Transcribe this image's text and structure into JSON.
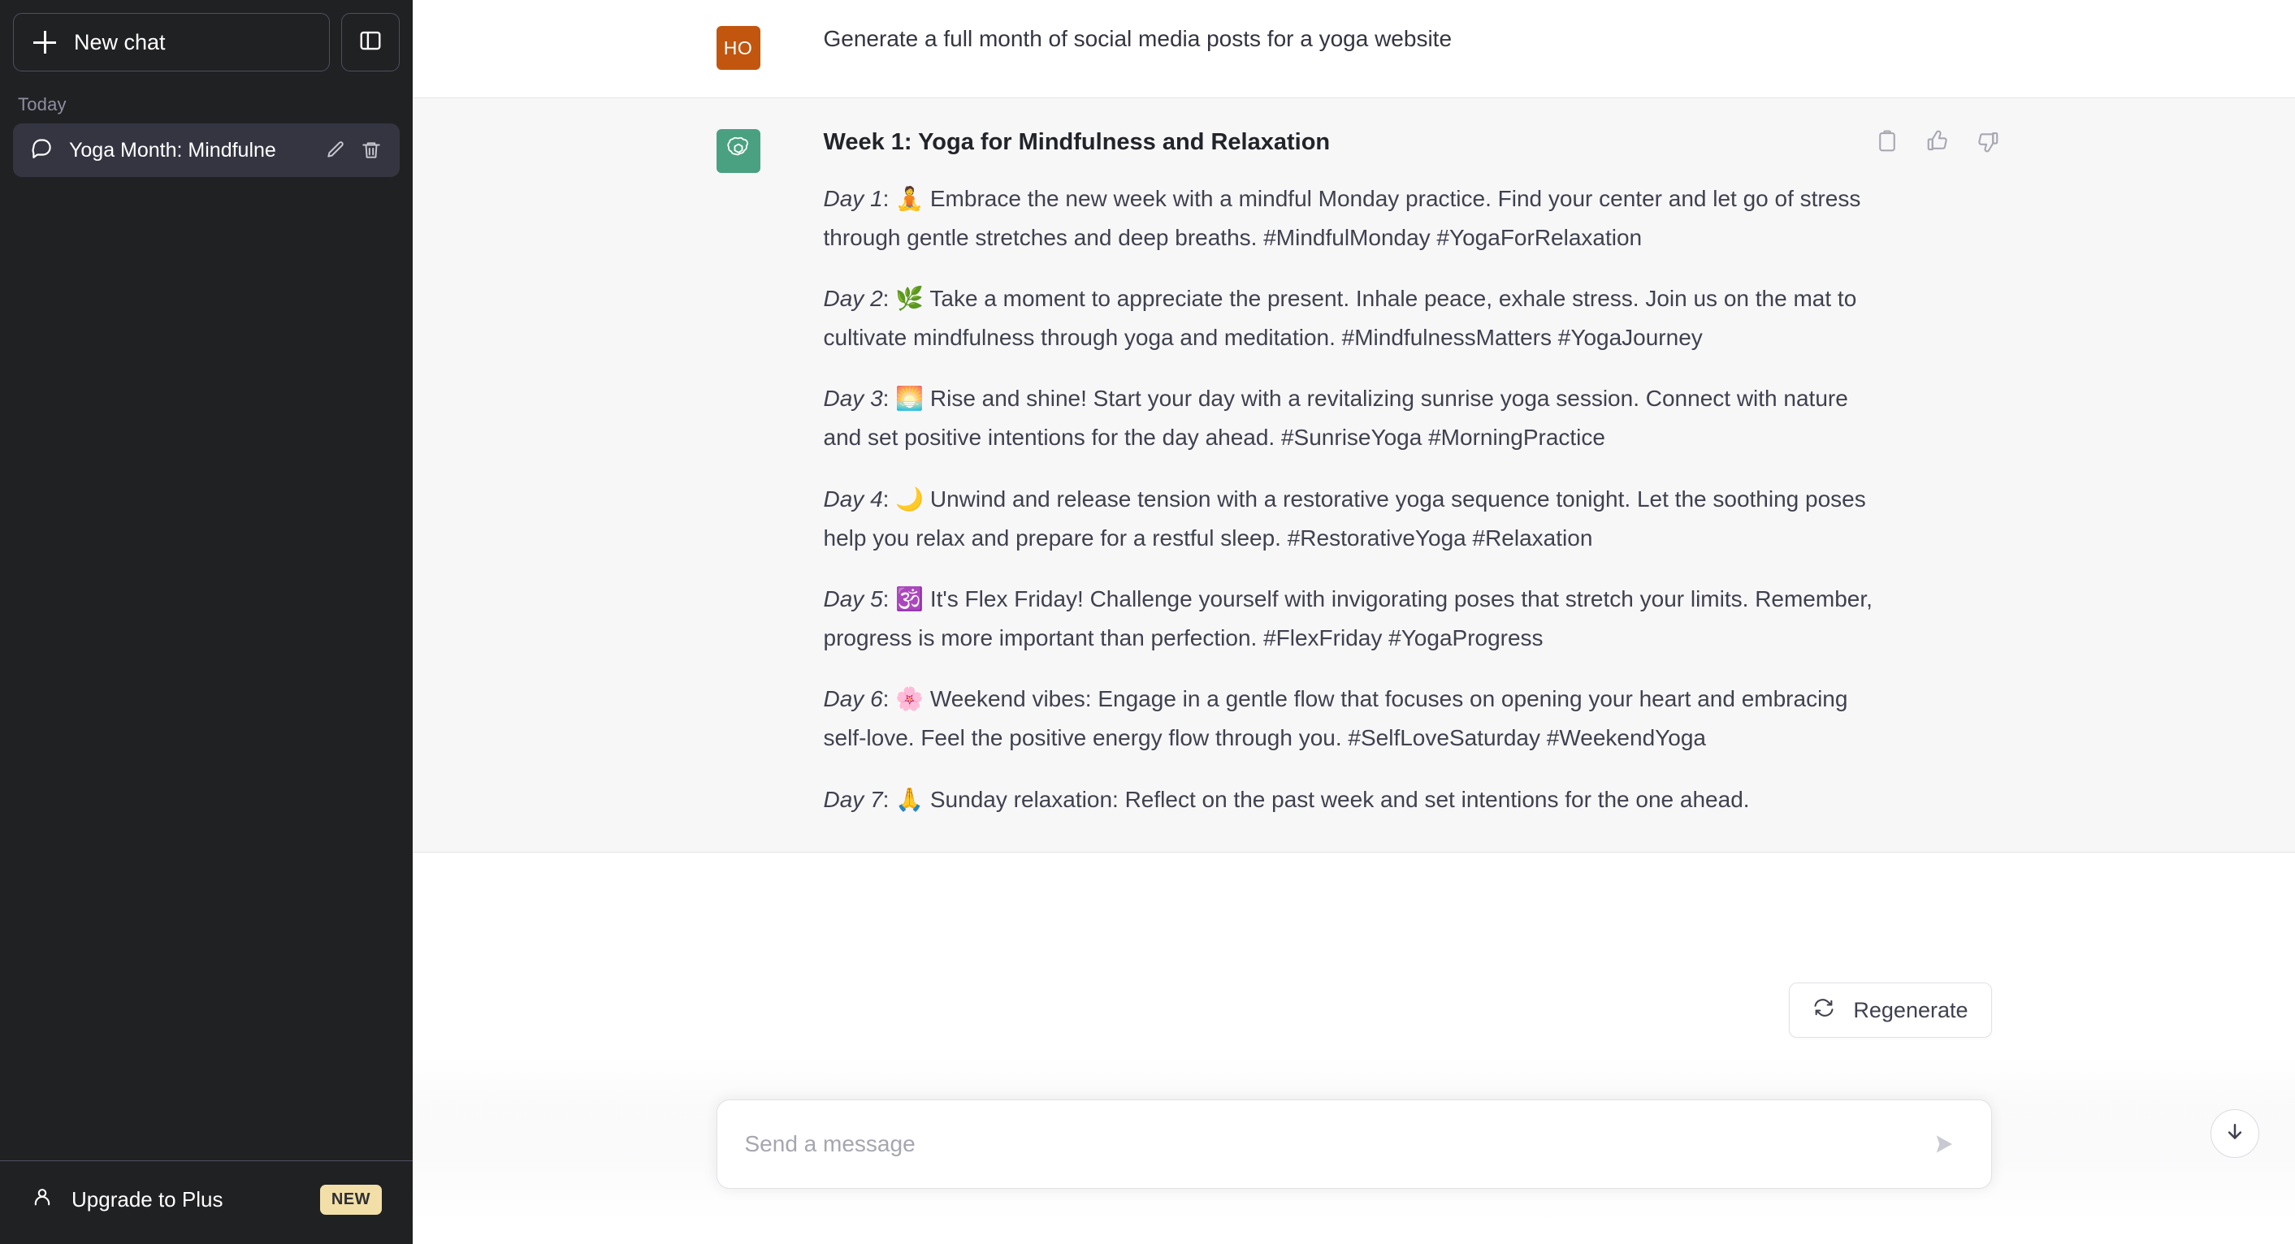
{
  "sidebar": {
    "new_chat_label": "New chat",
    "toggle_icon": "sidebar-panel-icon",
    "section_label": "Today",
    "chats": [
      {
        "title": "Yoga Month: Mindfulne",
        "icon": "chat-bubble-icon",
        "edit_icon": "pencil-icon",
        "delete_icon": "trash-icon",
        "active": true
      }
    ],
    "upgrade": {
      "label": "Upgrade to Plus",
      "badge": "NEW",
      "icon": "person-icon",
      "badge_color": "#f2dfa8"
    }
  },
  "conversation": {
    "user_message": {
      "avatar_initials": "HO",
      "avatar_color": "#c2560f",
      "text": "Generate a full month of social media posts for a yoga website"
    },
    "assistant_message": {
      "avatar_color": "#4aa181",
      "avatar_icon": "openai-logo-icon",
      "heading": "Week 1: Yoga for Mindfulness and Relaxation",
      "days": [
        {
          "label": "Day 1",
          "emoji": "🧘",
          "emoji_name": "person-in-lotus-position",
          "text": "Embrace the new week with a mindful Monday practice. Find your center and let go of stress through gentle stretches and deep breaths. #MindfulMonday #YogaForRelaxation"
        },
        {
          "label": "Day 2",
          "emoji": "🌿",
          "emoji_name": "herb-leaf",
          "text": "Take a moment to appreciate the present. Inhale peace, exhale stress. Join us on the mat to cultivate mindfulness through yoga and meditation. #MindfulnessMatters #YogaJourney"
        },
        {
          "label": "Day 3",
          "emoji": "🌅",
          "emoji_name": "sunrise",
          "text": "Rise and shine! Start your day with a revitalizing sunrise yoga session. Connect with nature and set positive intentions for the day ahead. #SunriseYoga #MorningPractice"
        },
        {
          "label": "Day 4",
          "emoji": "🌙",
          "emoji_name": "crescent-moon",
          "text": "Unwind and release tension with a restorative yoga sequence tonight. Let the soothing poses help you relax and prepare for a restful sleep. #RestorativeYoga #Relaxation"
        },
        {
          "label": "Day 5",
          "emoji": "🕉️",
          "emoji_name": "om-symbol",
          "text": "It's Flex Friday! Challenge yourself with invigorating poses that stretch your limits. Remember, progress is more important than perfection. #FlexFriday #YogaProgress"
        },
        {
          "label": "Day 6",
          "emoji": "🌸",
          "emoji_name": "cherry-blossom",
          "text": "Weekend vibes: Engage in a gentle flow that focuses on opening your heart and embracing self-love. Feel the positive energy flow through you. #SelfLoveSaturday #WeekendYoga"
        },
        {
          "label": "Day 7",
          "emoji": "🙏",
          "emoji_name": "folded-hands",
          "text": "Sunday relaxation: Reflect on the past week and set intentions for the one ahead."
        }
      ],
      "actions": [
        {
          "name": "copy-icon",
          "title": "Copy"
        },
        {
          "name": "thumbs-up-icon",
          "title": "Good response"
        },
        {
          "name": "thumbs-down-icon",
          "title": "Bad response"
        }
      ]
    }
  },
  "composer": {
    "placeholder": "Send a message",
    "value": "",
    "send_icon": "send-arrow-icon",
    "regenerate_label": "Regenerate",
    "regenerate_icon": "refresh-icon",
    "scroll_bottom_icon": "arrow-down-icon"
  }
}
